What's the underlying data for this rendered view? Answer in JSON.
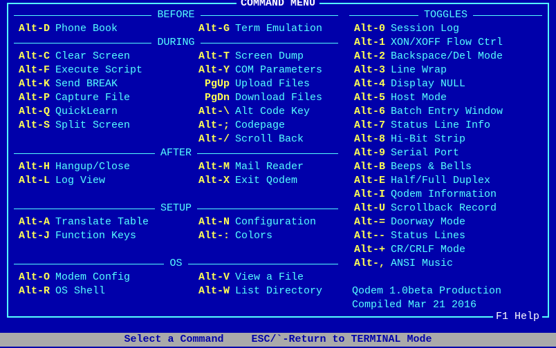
{
  "title": "COMMAND MENU",
  "f1": "F1 Help",
  "sections": {
    "before": "BEFORE",
    "during": "DURING",
    "after": "AFTER",
    "setup": "SETUP",
    "os": "OS",
    "toggles": "TOGGLES"
  },
  "left": {
    "before": [
      {
        "k": "Alt-D",
        "l": "Phone Book"
      }
    ],
    "before_r": [
      {
        "k": "Alt-G",
        "l": "Term Emulation"
      }
    ],
    "during": [
      {
        "k": "Alt-C",
        "l": "Clear Screen"
      },
      {
        "k": "Alt-F",
        "l": "Execute Script"
      },
      {
        "k": "Alt-K",
        "l": "Send BREAK"
      },
      {
        "k": "Alt-P",
        "l": "Capture File"
      },
      {
        "k": "Alt-Q",
        "l": "QuickLearn"
      },
      {
        "k": "Alt-S",
        "l": "Split Screen"
      }
    ],
    "during_r": [
      {
        "k": "Alt-T",
        "l": "Screen Dump"
      },
      {
        "k": "Alt-Y",
        "l": "COM Parameters"
      },
      {
        "k": "PgUp",
        "l": "Upload Files"
      },
      {
        "k": "PgDn",
        "l": "Download Files"
      },
      {
        "k": "Alt-\\",
        "l": "Alt Code Key"
      },
      {
        "k": "Alt-;",
        "l": "Codepage"
      },
      {
        "k": "Alt-/",
        "l": "Scroll Back"
      }
    ],
    "after": [
      {
        "k": "Alt-H",
        "l": "Hangup/Close"
      },
      {
        "k": "Alt-L",
        "l": "Log View"
      }
    ],
    "after_r": [
      {
        "k": "Alt-M",
        "l": "Mail Reader"
      },
      {
        "k": "Alt-X",
        "l": "Exit Qodem"
      }
    ],
    "setup": [
      {
        "k": "Alt-A",
        "l": "Translate Table"
      },
      {
        "k": "Alt-J",
        "l": "Function Keys"
      }
    ],
    "setup_r": [
      {
        "k": "Alt-N",
        "l": "Configuration"
      },
      {
        "k": "Alt-:",
        "l": "Colors"
      }
    ],
    "os": [
      {
        "k": "Alt-O",
        "l": "Modem Config"
      },
      {
        "k": "Alt-R",
        "l": "OS Shell"
      }
    ],
    "os_r": [
      {
        "k": "Alt-V",
        "l": "View a File"
      },
      {
        "k": "Alt-W",
        "l": "List Directory"
      }
    ]
  },
  "toggles": [
    {
      "k": "Alt-0",
      "l": "Session Log"
    },
    {
      "k": "Alt-1",
      "l": "XON/XOFF Flow Ctrl"
    },
    {
      "k": "Alt-2",
      "l": "Backspace/Del Mode"
    },
    {
      "k": "Alt-3",
      "l": "Line Wrap"
    },
    {
      "k": "Alt-4",
      "l": "Display NULL"
    },
    {
      "k": "Alt-5",
      "l": "Host Mode"
    },
    {
      "k": "Alt-6",
      "l": "Batch Entry Window"
    },
    {
      "k": "Alt-7",
      "l": "Status Line Info"
    },
    {
      "k": "Alt-8",
      "l": "Hi-Bit Strip"
    },
    {
      "k": "Alt-9",
      "l": "Serial Port"
    },
    {
      "k": "Alt-B",
      "l": "Beeps & Bells"
    },
    {
      "k": "Alt-E",
      "l": "Half/Full Duplex"
    },
    {
      "k": "Alt-I",
      "l": "Qodem Information"
    },
    {
      "k": "Alt-U",
      "l": "Scrollback Record"
    },
    {
      "k": "Alt-=",
      "l": "Doorway Mode"
    },
    {
      "k": "Alt--",
      "l": "Status Lines"
    },
    {
      "k": "Alt-+",
      "l": "CR/CRLF Mode"
    },
    {
      "k": "Alt-,",
      "l": "ANSI Music"
    }
  ],
  "info": {
    "line1": "Qodem 1.0beta Production",
    "line2": "Compiled Mar 21 2016"
  },
  "footer": {
    "select": "Select a Command",
    "esc": "ESC/`-Return to TERMINAL Mode"
  }
}
